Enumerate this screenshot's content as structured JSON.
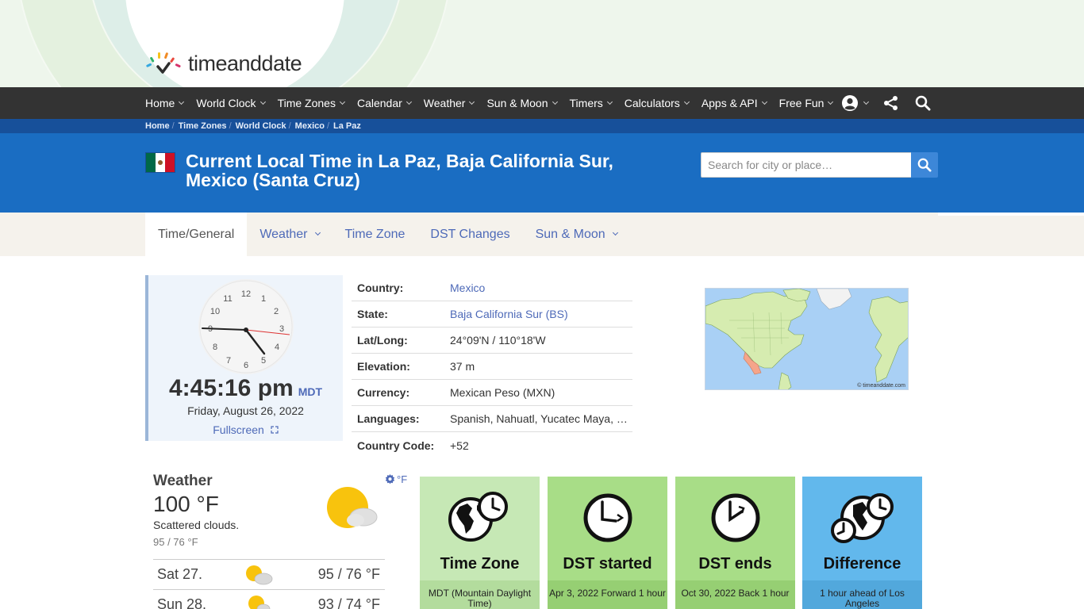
{
  "site": {
    "logo_text": "timeanddate"
  },
  "nav": {
    "items": [
      "Home",
      "World Clock",
      "Time Zones",
      "Calendar",
      "Weather",
      "Sun & Moon",
      "Timers",
      "Calculators",
      "Apps & API",
      "Free Fun"
    ]
  },
  "breadcrumb": [
    "Home",
    "Time Zones",
    "World Clock",
    "Mexico",
    "La Paz"
  ],
  "header": {
    "title": "Current Local Time in La Paz, Baja California Sur, Mexico (Santa Cruz)",
    "search_placeholder": "Search for city or place…"
  },
  "tabs": [
    "Time/General",
    "Weather",
    "Time Zone",
    "DST Changes",
    "Sun & Moon"
  ],
  "clock": {
    "time": "4:45:16 pm",
    "zone": "MDT",
    "date": "Friday, August 26, 2022",
    "fullscreen_label": "Fullscreen"
  },
  "info": [
    {
      "label": "Country:",
      "value": "Mexico"
    },
    {
      "label": "State:",
      "value": "Baja California Sur (BS)"
    },
    {
      "label": "Lat/Long:",
      "value": "24°09'N / 110°18'W"
    },
    {
      "label": "Elevation:",
      "value": "37 m"
    },
    {
      "label": "Currency:",
      "value": "Mexican Peso (MXN)"
    },
    {
      "label": "Languages:",
      "value": "Spanish, Nahuatl, Yucatec Maya, …"
    },
    {
      "label": "Country Code:",
      "value": "+52"
    }
  ],
  "map": {
    "copyright": "© timeanddate.com"
  },
  "weather": {
    "title": "Weather",
    "unit_toggle": "°F",
    "temp": "100 °F",
    "desc": "Scattered clouds.",
    "hilo": "95 / 76 °F",
    "forecast": [
      {
        "day": "Sat 27.",
        "temps": "95 / 76 °F"
      },
      {
        "day": "Sun 28.",
        "temps": "93 / 74 °F"
      }
    ]
  },
  "cards": [
    {
      "title": "Time Zone",
      "foot": "MDT (Mountain Daylight Time)"
    },
    {
      "title": "DST started",
      "foot": "Apr 3, 2022 Forward 1 hour"
    },
    {
      "title": "DST ends",
      "foot": "Oct 30, 2022 Back 1 hour"
    },
    {
      "title": "Difference",
      "foot": "1 hour ahead of Los Angeles"
    }
  ],
  "colors": {
    "nav_bg": "#333333",
    "band_blue": "#1a6dc2",
    "link": "#4e6ab8",
    "card_green_light": "#c6e8b5",
    "card_green": "#a8dd87",
    "card_blue": "#62b8ec"
  }
}
